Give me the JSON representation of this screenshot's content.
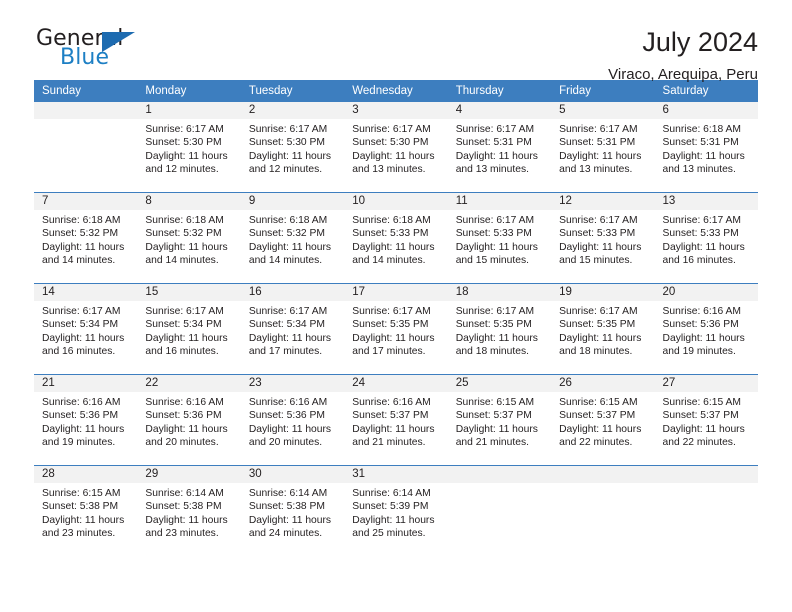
{
  "logo": {
    "primary_text": "General",
    "secondary_text": "Blue",
    "primary_color": "#231f20",
    "secondary_color": "#1d7fc4",
    "triangle_color": "#1d6bb0"
  },
  "header": {
    "title": "July 2024",
    "subtitle": "Viraco, Arequipa, Peru"
  },
  "theme": {
    "header_row_bg": "#3d7ebf",
    "header_row_text": "#ffffff",
    "daynum_band_bg": "#f2f2f2",
    "row_divider": "#3d7ebf",
    "body_text": "#231f20"
  },
  "calendar": {
    "weekday_headers": [
      "Sunday",
      "Monday",
      "Tuesday",
      "Wednesday",
      "Thursday",
      "Friday",
      "Saturday"
    ],
    "weeks": [
      [
        {
          "day": "",
          "lines": []
        },
        {
          "day": "1",
          "lines": [
            "Sunrise: 6:17 AM",
            "Sunset: 5:30 PM",
            "Daylight: 11 hours",
            "and 12 minutes."
          ]
        },
        {
          "day": "2",
          "lines": [
            "Sunrise: 6:17 AM",
            "Sunset: 5:30 PM",
            "Daylight: 11 hours",
            "and 12 minutes."
          ]
        },
        {
          "day": "3",
          "lines": [
            "Sunrise: 6:17 AM",
            "Sunset: 5:30 PM",
            "Daylight: 11 hours",
            "and 13 minutes."
          ]
        },
        {
          "day": "4",
          "lines": [
            "Sunrise: 6:17 AM",
            "Sunset: 5:31 PM",
            "Daylight: 11 hours",
            "and 13 minutes."
          ]
        },
        {
          "day": "5",
          "lines": [
            "Sunrise: 6:17 AM",
            "Sunset: 5:31 PM",
            "Daylight: 11 hours",
            "and 13 minutes."
          ]
        },
        {
          "day": "6",
          "lines": [
            "Sunrise: 6:18 AM",
            "Sunset: 5:31 PM",
            "Daylight: 11 hours",
            "and 13 minutes."
          ]
        }
      ],
      [
        {
          "day": "7",
          "lines": [
            "Sunrise: 6:18 AM",
            "Sunset: 5:32 PM",
            "Daylight: 11 hours",
            "and 14 minutes."
          ]
        },
        {
          "day": "8",
          "lines": [
            "Sunrise: 6:18 AM",
            "Sunset: 5:32 PM",
            "Daylight: 11 hours",
            "and 14 minutes."
          ]
        },
        {
          "day": "9",
          "lines": [
            "Sunrise: 6:18 AM",
            "Sunset: 5:32 PM",
            "Daylight: 11 hours",
            "and 14 minutes."
          ]
        },
        {
          "day": "10",
          "lines": [
            "Sunrise: 6:18 AM",
            "Sunset: 5:33 PM",
            "Daylight: 11 hours",
            "and 14 minutes."
          ]
        },
        {
          "day": "11",
          "lines": [
            "Sunrise: 6:17 AM",
            "Sunset: 5:33 PM",
            "Daylight: 11 hours",
            "and 15 minutes."
          ]
        },
        {
          "day": "12",
          "lines": [
            "Sunrise: 6:17 AM",
            "Sunset: 5:33 PM",
            "Daylight: 11 hours",
            "and 15 minutes."
          ]
        },
        {
          "day": "13",
          "lines": [
            "Sunrise: 6:17 AM",
            "Sunset: 5:33 PM",
            "Daylight: 11 hours",
            "and 16 minutes."
          ]
        }
      ],
      [
        {
          "day": "14",
          "lines": [
            "Sunrise: 6:17 AM",
            "Sunset: 5:34 PM",
            "Daylight: 11 hours",
            "and 16 minutes."
          ]
        },
        {
          "day": "15",
          "lines": [
            "Sunrise: 6:17 AM",
            "Sunset: 5:34 PM",
            "Daylight: 11 hours",
            "and 16 minutes."
          ]
        },
        {
          "day": "16",
          "lines": [
            "Sunrise: 6:17 AM",
            "Sunset: 5:34 PM",
            "Daylight: 11 hours",
            "and 17 minutes."
          ]
        },
        {
          "day": "17",
          "lines": [
            "Sunrise: 6:17 AM",
            "Sunset: 5:35 PM",
            "Daylight: 11 hours",
            "and 17 minutes."
          ]
        },
        {
          "day": "18",
          "lines": [
            "Sunrise: 6:17 AM",
            "Sunset: 5:35 PM",
            "Daylight: 11 hours",
            "and 18 minutes."
          ]
        },
        {
          "day": "19",
          "lines": [
            "Sunrise: 6:17 AM",
            "Sunset: 5:35 PM",
            "Daylight: 11 hours",
            "and 18 minutes."
          ]
        },
        {
          "day": "20",
          "lines": [
            "Sunrise: 6:16 AM",
            "Sunset: 5:36 PM",
            "Daylight: 11 hours",
            "and 19 minutes."
          ]
        }
      ],
      [
        {
          "day": "21",
          "lines": [
            "Sunrise: 6:16 AM",
            "Sunset: 5:36 PM",
            "Daylight: 11 hours",
            "and 19 minutes."
          ]
        },
        {
          "day": "22",
          "lines": [
            "Sunrise: 6:16 AM",
            "Sunset: 5:36 PM",
            "Daylight: 11 hours",
            "and 20 minutes."
          ]
        },
        {
          "day": "23",
          "lines": [
            "Sunrise: 6:16 AM",
            "Sunset: 5:36 PM",
            "Daylight: 11 hours",
            "and 20 minutes."
          ]
        },
        {
          "day": "24",
          "lines": [
            "Sunrise: 6:16 AM",
            "Sunset: 5:37 PM",
            "Daylight: 11 hours",
            "and 21 minutes."
          ]
        },
        {
          "day": "25",
          "lines": [
            "Sunrise: 6:15 AM",
            "Sunset: 5:37 PM",
            "Daylight: 11 hours",
            "and 21 minutes."
          ]
        },
        {
          "day": "26",
          "lines": [
            "Sunrise: 6:15 AM",
            "Sunset: 5:37 PM",
            "Daylight: 11 hours",
            "and 22 minutes."
          ]
        },
        {
          "day": "27",
          "lines": [
            "Sunrise: 6:15 AM",
            "Sunset: 5:37 PM",
            "Daylight: 11 hours",
            "and 22 minutes."
          ]
        }
      ],
      [
        {
          "day": "28",
          "lines": [
            "Sunrise: 6:15 AM",
            "Sunset: 5:38 PM",
            "Daylight: 11 hours",
            "and 23 minutes."
          ]
        },
        {
          "day": "29",
          "lines": [
            "Sunrise: 6:14 AM",
            "Sunset: 5:38 PM",
            "Daylight: 11 hours",
            "and 23 minutes."
          ]
        },
        {
          "day": "30",
          "lines": [
            "Sunrise: 6:14 AM",
            "Sunset: 5:38 PM",
            "Daylight: 11 hours",
            "and 24 minutes."
          ]
        },
        {
          "day": "31",
          "lines": [
            "Sunrise: 6:14 AM",
            "Sunset: 5:39 PM",
            "Daylight: 11 hours",
            "and 25 minutes."
          ]
        },
        {
          "day": "",
          "lines": []
        },
        {
          "day": "",
          "lines": []
        },
        {
          "day": "",
          "lines": []
        }
      ]
    ]
  }
}
